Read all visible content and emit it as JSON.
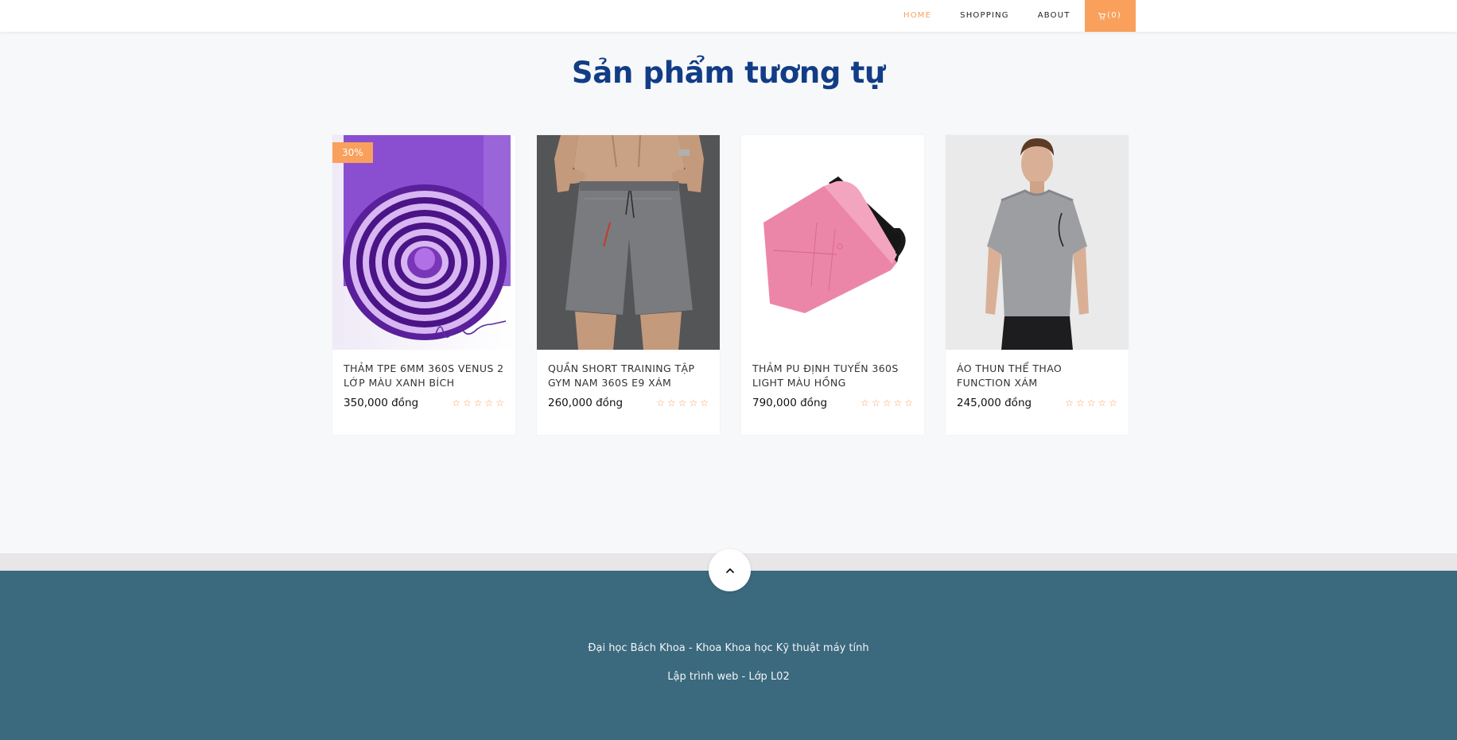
{
  "nav": {
    "items": [
      {
        "label": "HOME",
        "active": true
      },
      {
        "label": "SHOPPING",
        "active": false
      },
      {
        "label": "ABOUT",
        "active": false
      }
    ],
    "cart_label": "(0)",
    "cart_icon": "cart-icon"
  },
  "section": {
    "title": "Sản phẩm tương tự"
  },
  "products": [
    {
      "name": "THẢM TPE 6MM 360S VENUS 2 LỚP MÀU XANH BÍCH",
      "price": "350,000 đồng",
      "badge": "30%",
      "rating": 0
    },
    {
      "name": "QUẦN SHORT TRAINING TẬP GYM NAM 360S E9 XÁM",
      "price": "260,000 đồng",
      "badge": "",
      "rating": 0
    },
    {
      "name": "THẢM PU ĐỊNH TUYẾN 360S LIGHT MÀU HỒNG",
      "price": "790,000 đồng",
      "badge": "",
      "rating": 0
    },
    {
      "name": "ÁO THUN THỂ THAO FUNCTION XÁM",
      "price": "245,000 đồng",
      "badge": "",
      "rating": 0
    }
  ],
  "star_glyph": "☆",
  "footer": {
    "line1": "Đại học Bách Khoa - Khoa Khoa học Kỹ thuật máy tính",
    "line2": "Lập trình web - Lớp L02",
    "back_to_top_icon": "chevron-up-icon"
  },
  "colors": {
    "accent": "#f9a05c",
    "title": "#123d86",
    "footer_bg": "#3b697e"
  }
}
